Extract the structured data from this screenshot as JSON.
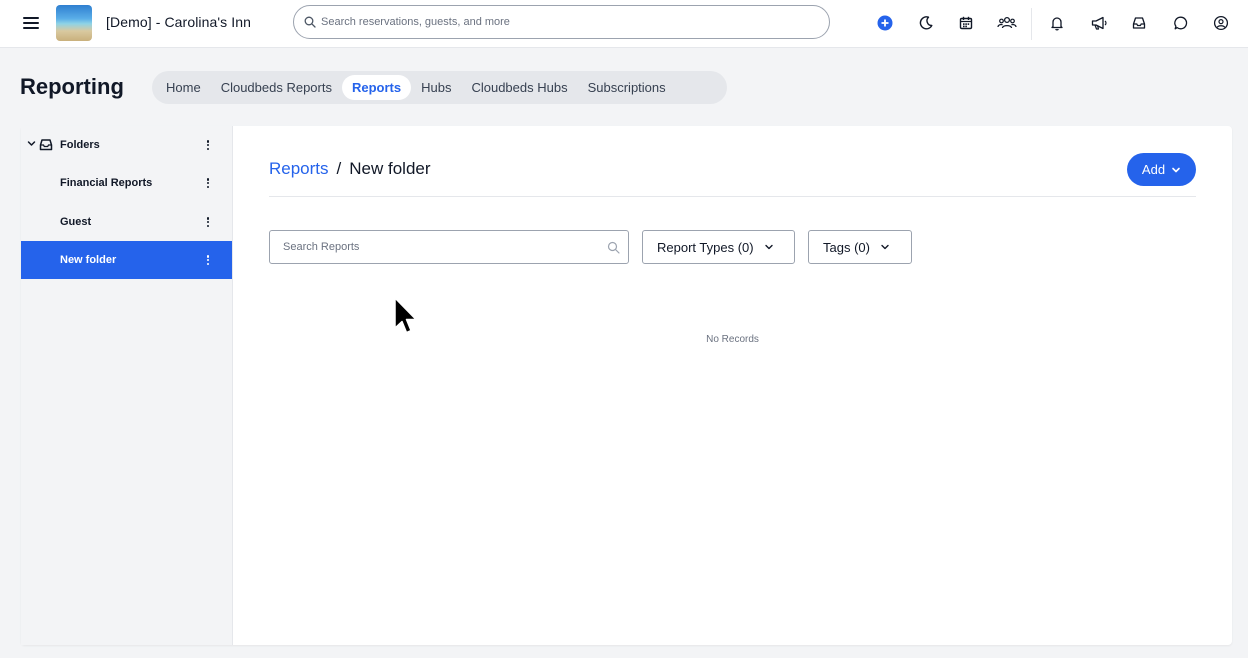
{
  "header": {
    "property_name": "[Demo] - Carolina's Inn",
    "search_placeholder": "Search reservations, guests, and more",
    "icons": [
      "menu-icon",
      "add-circle-icon",
      "moon-icon",
      "calendar-icon",
      "users-icon",
      "bell-icon",
      "megaphone-icon",
      "inbox-icon",
      "chat-icon",
      "user-circle-icon"
    ]
  },
  "page": {
    "title": "Reporting",
    "tabs": [
      {
        "label": "Home",
        "active": false
      },
      {
        "label": "Cloudbeds Reports",
        "active": false
      },
      {
        "label": "Reports",
        "active": true
      },
      {
        "label": "Hubs",
        "active": false
      },
      {
        "label": "Cloudbeds Hubs",
        "active": false
      },
      {
        "label": "Subscriptions",
        "active": false
      }
    ]
  },
  "sidebar": {
    "root_label": "Folders",
    "folders": [
      {
        "label": "Financial Reports",
        "selected": false
      },
      {
        "label": "Guest",
        "selected": false
      },
      {
        "label": "New folder",
        "selected": true
      }
    ]
  },
  "main": {
    "breadcrumb_parent": "Reports",
    "breadcrumb_separator": "/",
    "breadcrumb_current": "New folder",
    "add_label": "Add",
    "search_placeholder": "Search Reports",
    "report_types_label": "Report Types (0)",
    "tags_label": "Tags (0)",
    "empty_message": "No Records"
  },
  "colors": {
    "accent": "#2563eb",
    "sidebar_bg": "#f3f4f6",
    "page_bg": "#f3f4f6"
  }
}
